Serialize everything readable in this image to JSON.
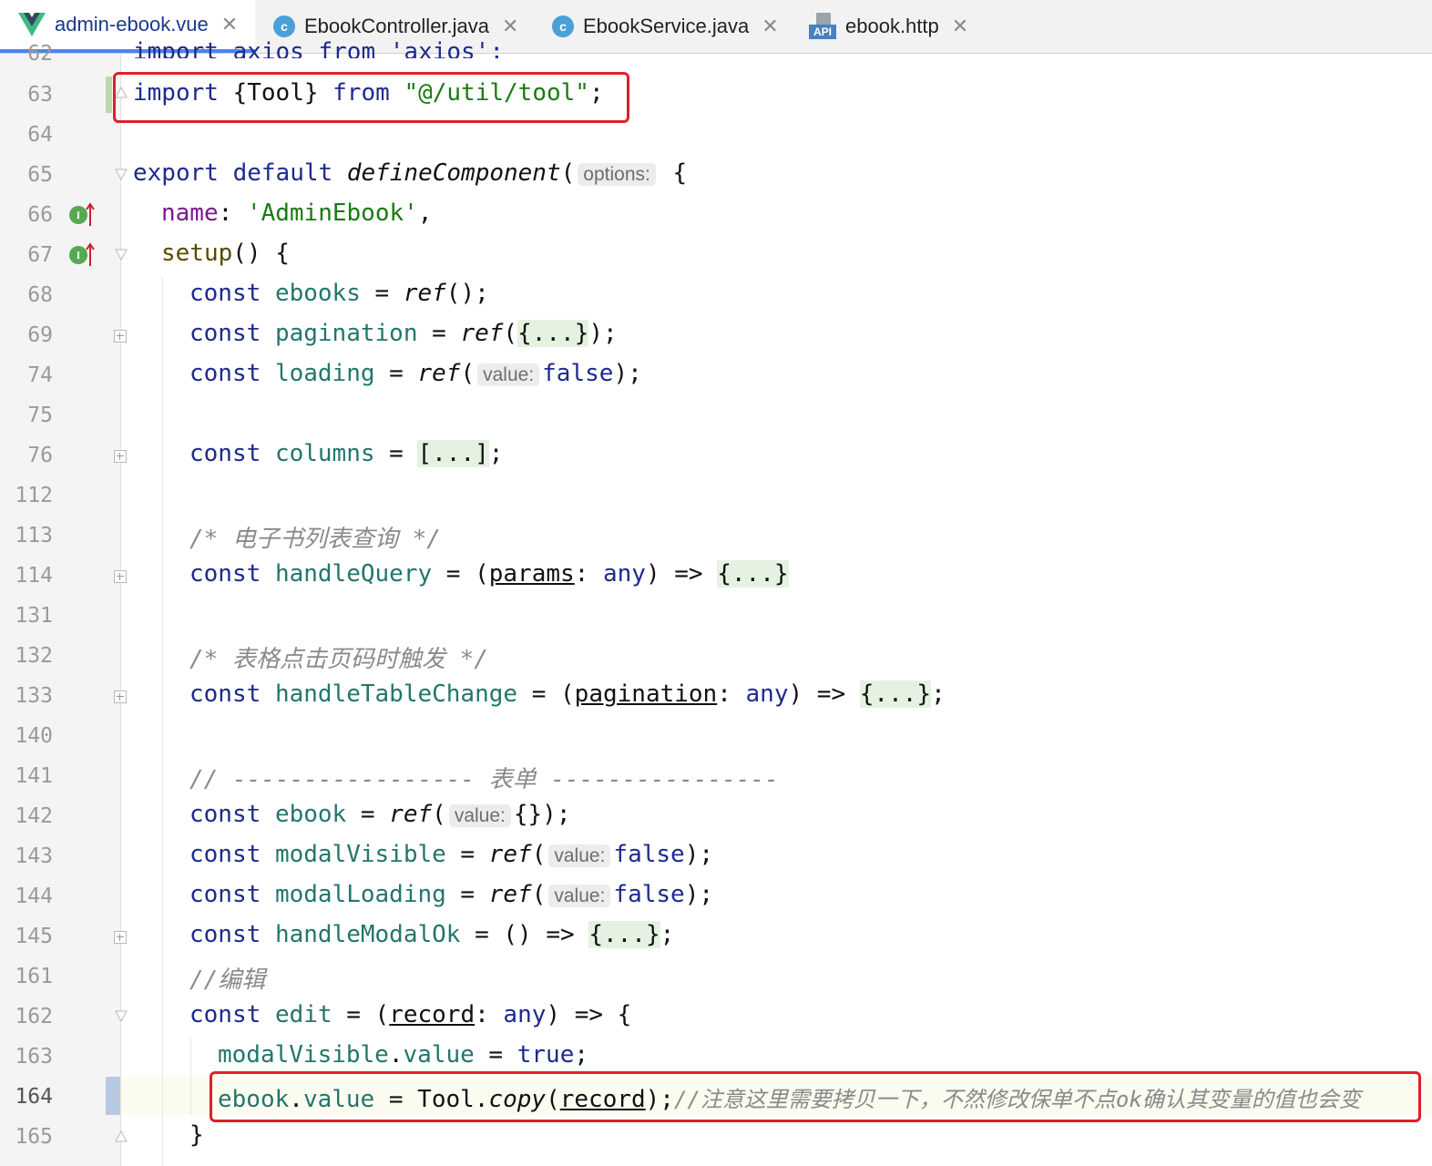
{
  "tabs": [
    {
      "label": "admin-ebook.vue",
      "icon": "vue-icon",
      "active": true
    },
    {
      "label": "EbookController.java",
      "icon": "java-class-icon",
      "active": false
    },
    {
      "label": "EbookService.java",
      "icon": "java-class-icon",
      "active": false
    },
    {
      "label": "ebook.http",
      "icon": "api-http-icon",
      "active": false
    }
  ],
  "close_glyph": "✕",
  "c_glyph": "c",
  "api_glyph": "API",
  "impl_glyph": "I",
  "line_numbers": [
    "62",
    "63",
    "64",
    "65",
    "66",
    "67",
    "68",
    "69",
    "74",
    "75",
    "76",
    "112",
    "113",
    "114",
    "131",
    "132",
    "133",
    "140",
    "141",
    "142",
    "143",
    "144",
    "145",
    "161",
    "162",
    "163",
    "164",
    "165"
  ],
  "current_line": "164",
  "code": {
    "l62": "import axios from 'axios';",
    "l63": {
      "kw1": "import",
      "p1": " {Tool} ",
      "kw2": "from",
      "sp": " ",
      "str": "\"@/util/tool\"",
      "end": ";"
    },
    "l65": {
      "kw1": "export",
      "kw2": "default",
      "fn": "defineComponent",
      "open": "(",
      "hint": "options:",
      "close": " {"
    },
    "l66": {
      "prop": "name",
      "colon": ": ",
      "str": "'AdminEbook'",
      "end": ","
    },
    "l67": {
      "fn": "setup",
      "rest": "() {"
    },
    "l68": {
      "kw": "const",
      "var": "ebooks",
      "eq": " = ",
      "fn": "ref",
      "rest": "();"
    },
    "l69": {
      "kw": "const",
      "var": "pagination",
      "eq": " = ",
      "fn": "ref",
      "open": "(",
      "fold": "{...}",
      "rest": ");"
    },
    "l74": {
      "kw": "const",
      "var": "loading",
      "eq": " = ",
      "fn": "ref",
      "open": "(",
      "hint": "value:",
      "val": "false",
      "rest": ");"
    },
    "l76": {
      "kw": "const",
      "var": "columns",
      "eq": " = ",
      "fold": "[...]",
      "rest": ";"
    },
    "l113": "/* 电子书列表查询 */",
    "l114": {
      "kw": "const",
      "var": "handleQuery",
      "eq": " = (",
      "param": "params",
      "colon": ": ",
      "type": "any",
      "arrow": ") => ",
      "fold": "{...}"
    },
    "l132": "/* 表格点击页码时触发 */",
    "l133": {
      "kw": "const",
      "var": "handleTableChange",
      "eq": " = (",
      "param": "pagination",
      "colon": ": ",
      "type": "any",
      "arrow": ") => ",
      "fold": "{...}",
      "rest": ";"
    },
    "l141": "// ----------------- 表单 ----------------",
    "l142": {
      "kw": "const",
      "var": "ebook",
      "eq": " = ",
      "fn": "ref",
      "open": "(",
      "hint": "value:",
      "val": "{}",
      "rest": ");"
    },
    "l143": {
      "kw": "const",
      "var": "modalVisible",
      "eq": " = ",
      "fn": "ref",
      "open": "(",
      "hint": "value:",
      "val": "false",
      "rest": ");"
    },
    "l144": {
      "kw": "const",
      "var": "modalLoading",
      "eq": " = ",
      "fn": "ref",
      "open": "(",
      "hint": "value:",
      "val": "false",
      "rest": ");"
    },
    "l145": {
      "kw": "const",
      "var": "handleModalOk",
      "eq": " = () => ",
      "fold": "{...}",
      "rest": ";"
    },
    "l161": "//编辑",
    "l162": {
      "kw": "const",
      "var": "edit",
      "eq": " = (",
      "param": "record",
      "colon": ": ",
      "type": "any",
      "arrow": ") => {"
    },
    "l163": {
      "var": "modalVisible",
      "dot": ".",
      "prop": "value",
      "eq": " = ",
      "val": "true",
      "end": ";"
    },
    "l164": {
      "var": "ebook",
      "dot": ".",
      "prop": "value",
      "eq": " = Tool.",
      "fn": "copy",
      "open": "(",
      "param": "record",
      "end": ");",
      "comment": "//注意这里需要拷贝一下，不然修改保单不点ok确认其变量的值也会变"
    },
    "l165": "}"
  },
  "colors": {
    "highlight_border": "#e0202a",
    "active_tab_underline": "#4a86e8"
  }
}
